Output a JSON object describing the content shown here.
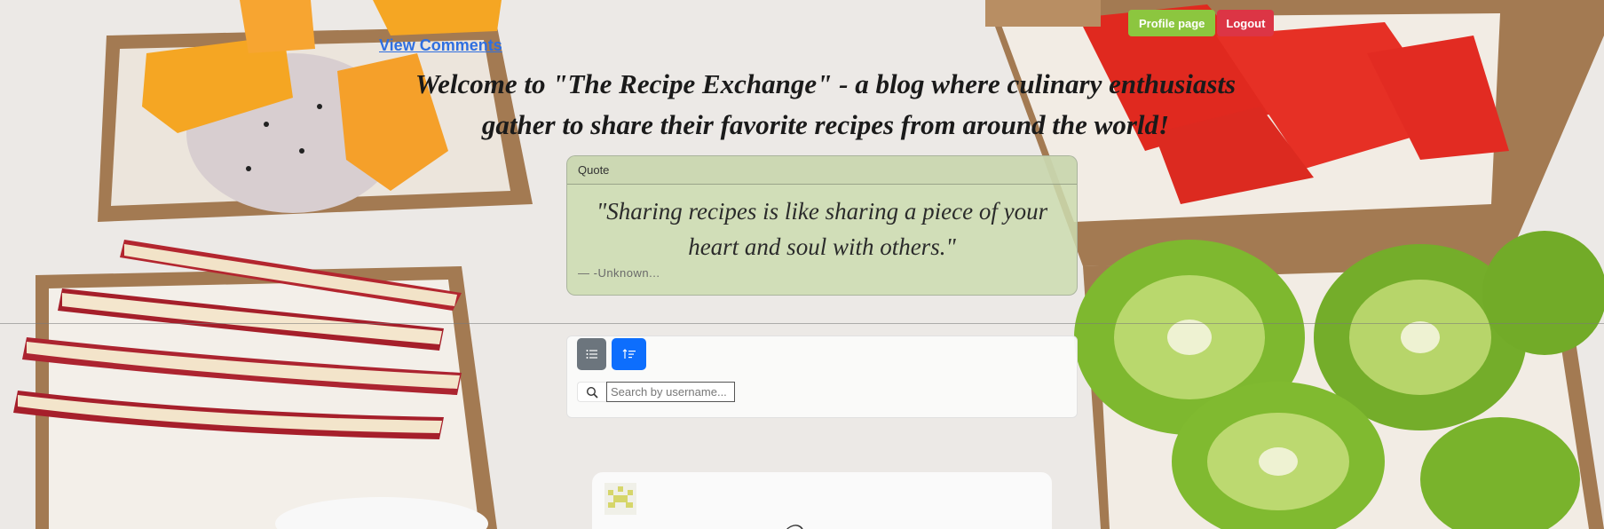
{
  "header": {
    "profile_button": "Profile page",
    "logout_button": "Logout",
    "view_comments_link": "View Comments",
    "welcome_text": "Welcome to \"The Recipe Exchange\" - a blog where culinary enthusiasts gather to share their favorite recipes from around the world!"
  },
  "quote": {
    "header": "Quote",
    "text": "\"Sharing recipes is like sharing a piece of your heart and soul with others.\"",
    "author": "— -Unknown..."
  },
  "toolbar": {
    "list_view_icon": "list-icon",
    "sort_icon": "sort-ascending-icon",
    "search_placeholder": "Search by username..."
  },
  "post": {
    "avatar_icon": "identicon-avatar",
    "partial_text": "◯ ... · ."
  },
  "colors": {
    "profile_button": "#8cc63f",
    "logout_button": "#dc3545",
    "link": "#2f6fe0",
    "sort_button": "#0d6efd",
    "list_button": "#6c757d"
  }
}
